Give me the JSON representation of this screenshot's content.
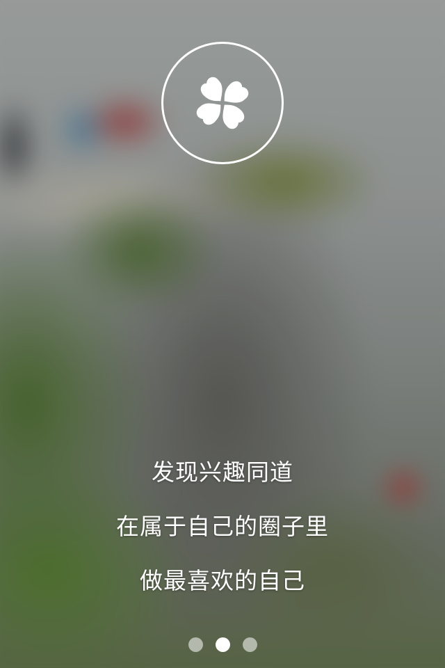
{
  "intro": {
    "lines": [
      "发现兴趣同道",
      "在属于自己的圈子里",
      "做最喜欢的自己"
    ]
  },
  "logo": {
    "icon": "four-leaf-clover-icon"
  },
  "pager": {
    "total": 3,
    "active_index": 1
  },
  "colors": {
    "text": "#ffffff",
    "dot_inactive": "rgba(255,255,255,0.55)",
    "dot_active": "#ffffff"
  }
}
